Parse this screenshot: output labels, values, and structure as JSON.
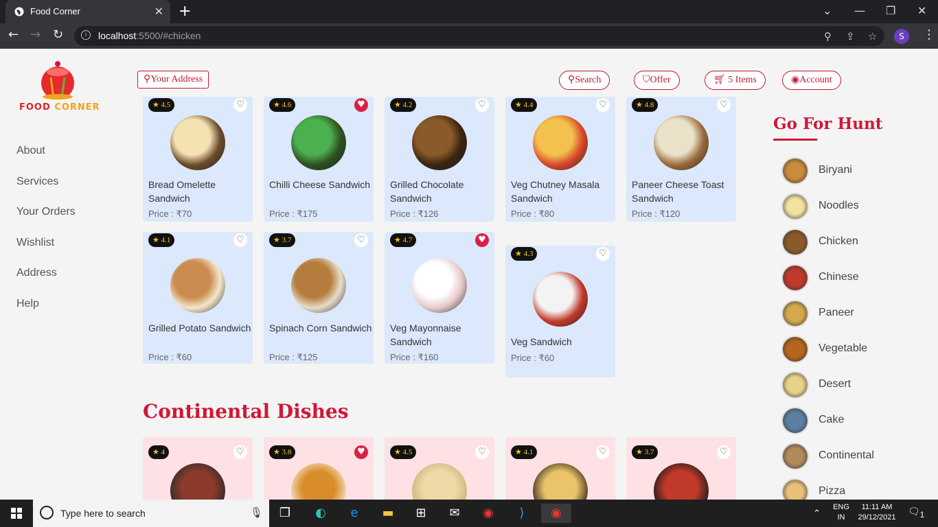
{
  "browser": {
    "tab_title": "Food Corner",
    "url_host": "localhost",
    "url_rest": ":5500/#chicken",
    "profile_initial": "S"
  },
  "brand": {
    "name_part1": "FOOD ",
    "name_part2": "CORNER"
  },
  "sidenav": [
    "About",
    "Services",
    "Your Orders",
    "Wishlist",
    "Address",
    "Help"
  ],
  "topbar": {
    "address": "Your Address",
    "search": "Search",
    "offer": "Offer",
    "cart": "5 Items",
    "account": "Account"
  },
  "sandwiches": [
    {
      "rating": "4.5",
      "name": "Bread Omelette Sandwich",
      "price": "Price : ₹70",
      "liked": false
    },
    {
      "rating": "4.6",
      "name": "Chilli Cheese Sandwich",
      "price": "Price : ₹175",
      "liked": true
    },
    {
      "rating": "4.2",
      "name": "Grilled Chocolate Sandwich",
      "price": "Price : ₹126",
      "liked": false
    },
    {
      "rating": "4.4",
      "name": "Veg Chutney Masala Sandwich",
      "price": "Price : ₹80",
      "liked": false
    },
    {
      "rating": "4.8",
      "name": "Paneer Cheese Toast Sandwich",
      "price": "Price : ₹120",
      "liked": false
    },
    {
      "rating": "4.1",
      "name": "Grilled Potato Sandwich",
      "price": "Price : ₹60",
      "liked": false
    },
    {
      "rating": "3.7",
      "name": "Spinach Corn Sandwich",
      "price": "Price : ₹125",
      "liked": false
    },
    {
      "rating": "4.7",
      "name": "Veg Mayonnaise Sandwich",
      "price": "Price : ₹160",
      "liked": true
    },
    {
      "rating": "4.3",
      "name": "Veg Sandwich",
      "price": "Price : ₹60",
      "liked": false
    }
  ],
  "continental": {
    "title": "Continental Dishes",
    "items": [
      {
        "rating": "4",
        "liked": false
      },
      {
        "rating": "3.8",
        "liked": true
      },
      {
        "rating": "4.5",
        "liked": false
      },
      {
        "rating": "4.1",
        "liked": false
      },
      {
        "rating": "3.7",
        "liked": false
      }
    ]
  },
  "hunt": {
    "title": "Go For Hunt",
    "items": [
      "Biryani",
      "Noodles",
      "Chicken",
      "Chinese",
      "Paneer",
      "Vegetable",
      "Desert",
      "Cake",
      "Continental",
      "Pizza"
    ]
  },
  "taskbar": {
    "search_placeholder": "Type here to search",
    "lang1": "ENG",
    "lang2": "IN",
    "time": "11:11 AM",
    "date": "29/12/2021",
    "notif": "1"
  },
  "colors": {
    "accent": "#d11735",
    "card_blue": "#dce8fb",
    "card_pink": "#fde1e5"
  }
}
